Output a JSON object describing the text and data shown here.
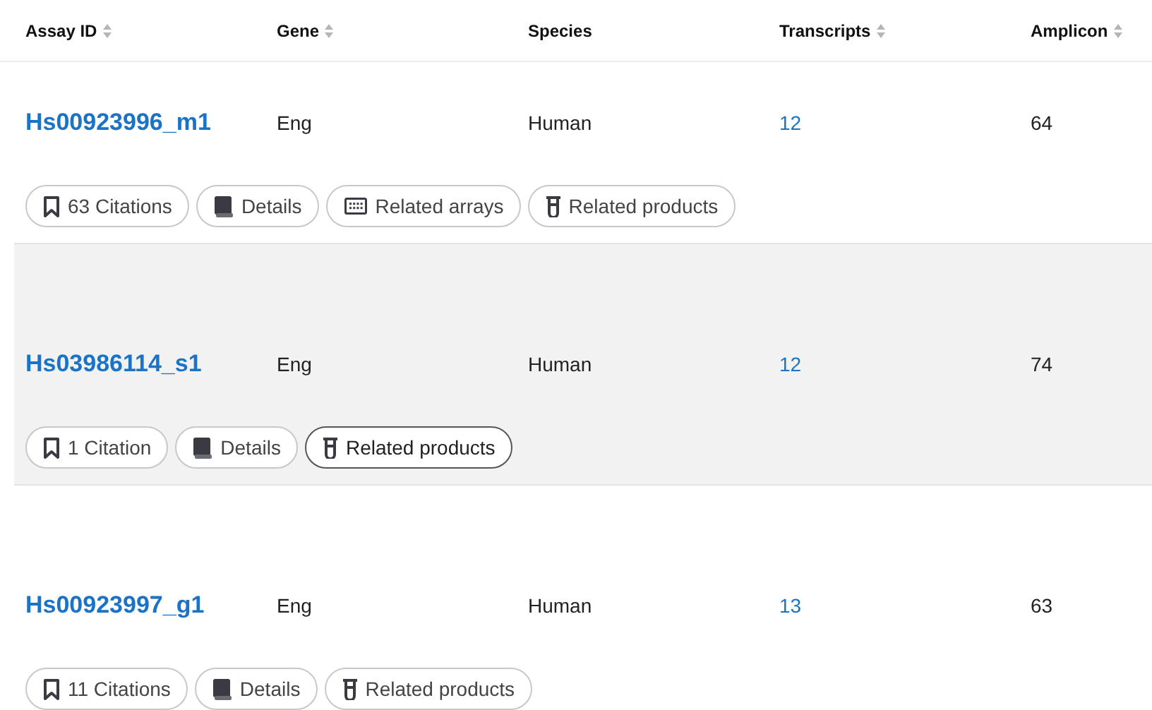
{
  "columns": [
    {
      "label": "Assay ID",
      "sortable": true
    },
    {
      "label": "Gene",
      "sortable": true
    },
    {
      "label": "Species",
      "sortable": false
    },
    {
      "label": "Transcripts",
      "sortable": true
    },
    {
      "label": "Amplicon",
      "sortable": true
    }
  ],
  "rows": [
    {
      "assay_id": "Hs00923996_m1",
      "gene": "Eng",
      "species": "Human",
      "transcripts": "12",
      "amplicon": "64",
      "hovered": false,
      "actions": [
        {
          "kind": "citations",
          "label": "63 Citations",
          "hovered": false
        },
        {
          "kind": "details",
          "label": "Details",
          "hovered": false
        },
        {
          "kind": "arrays",
          "label": "Related arrays",
          "hovered": false
        },
        {
          "kind": "products",
          "label": "Related products",
          "hovered": false
        }
      ]
    },
    {
      "assay_id": "Hs03986114_s1",
      "gene": "Eng",
      "species": "Human",
      "transcripts": "12",
      "amplicon": "74",
      "hovered": true,
      "actions": [
        {
          "kind": "citations",
          "label": "1 Citation",
          "hovered": false
        },
        {
          "kind": "details",
          "label": "Details",
          "hovered": false
        },
        {
          "kind": "products",
          "label": "Related products",
          "hovered": true
        }
      ]
    },
    {
      "assay_id": "Hs00923997_g1",
      "gene": "Eng",
      "species": "Human",
      "transcripts": "13",
      "amplicon": "63",
      "hovered": false,
      "actions": [
        {
          "kind": "citations",
          "label": "11 Citations",
          "hovered": false
        },
        {
          "kind": "details",
          "label": "Details",
          "hovered": false
        },
        {
          "kind": "products",
          "label": "Related products",
          "hovered": false
        }
      ]
    }
  ]
}
